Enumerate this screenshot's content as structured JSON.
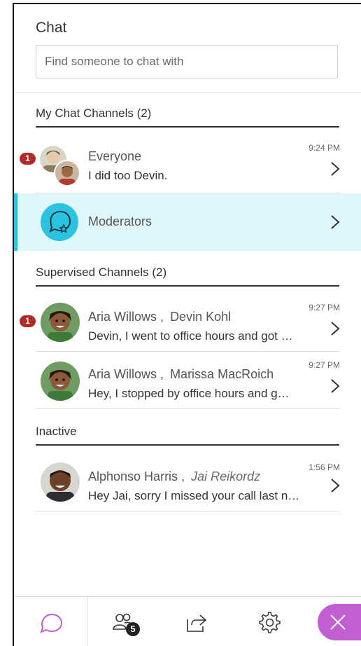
{
  "panel": {
    "title": "Chat",
    "search_placeholder": "Find someone to chat with"
  },
  "sections": {
    "my_channels": "My Chat Channels (2)",
    "supervised": "Supervised Channels (2)",
    "inactive": "Inactive"
  },
  "channels": {
    "everyone": {
      "badge": "1",
      "name": "Everyone",
      "message": "I did too Devin.",
      "time": "9:24 PM"
    },
    "moderators": {
      "name": "Moderators"
    },
    "aria_devin": {
      "badge": "1",
      "name1": "Aria Willows",
      "sep": ",",
      "name2": "Devin Kohl",
      "message": "Devin, I went to office hours and got …",
      "time": "9:27 PM"
    },
    "aria_marissa": {
      "name1": "Aria Willows",
      "sep": ",",
      "name2": "Marissa MacRoich",
      "message": "Hey, I stopped by office hours and g…",
      "time": "9:27 PM"
    },
    "alphonso_jai": {
      "name1": "Alphonso Harris",
      "sep": ",",
      "name2": "Jai Reikordz",
      "message": "Hey Jai, sorry I missed your call last n…",
      "time": "1:56 PM"
    }
  },
  "tabs": {
    "attendees_count": "5"
  },
  "icons": {
    "chat_tab": "chat-bubble-icon",
    "attendees_tab": "people-icon",
    "share_tab": "share-icon",
    "settings_tab": "gear-icon",
    "close": "close-icon",
    "moderators": "chat-star-icon"
  },
  "colors": {
    "accent": "#c15fd2",
    "active_row": "#dff6fb",
    "active_bar": "#2cc3e2",
    "badge": "#b12a2a"
  }
}
